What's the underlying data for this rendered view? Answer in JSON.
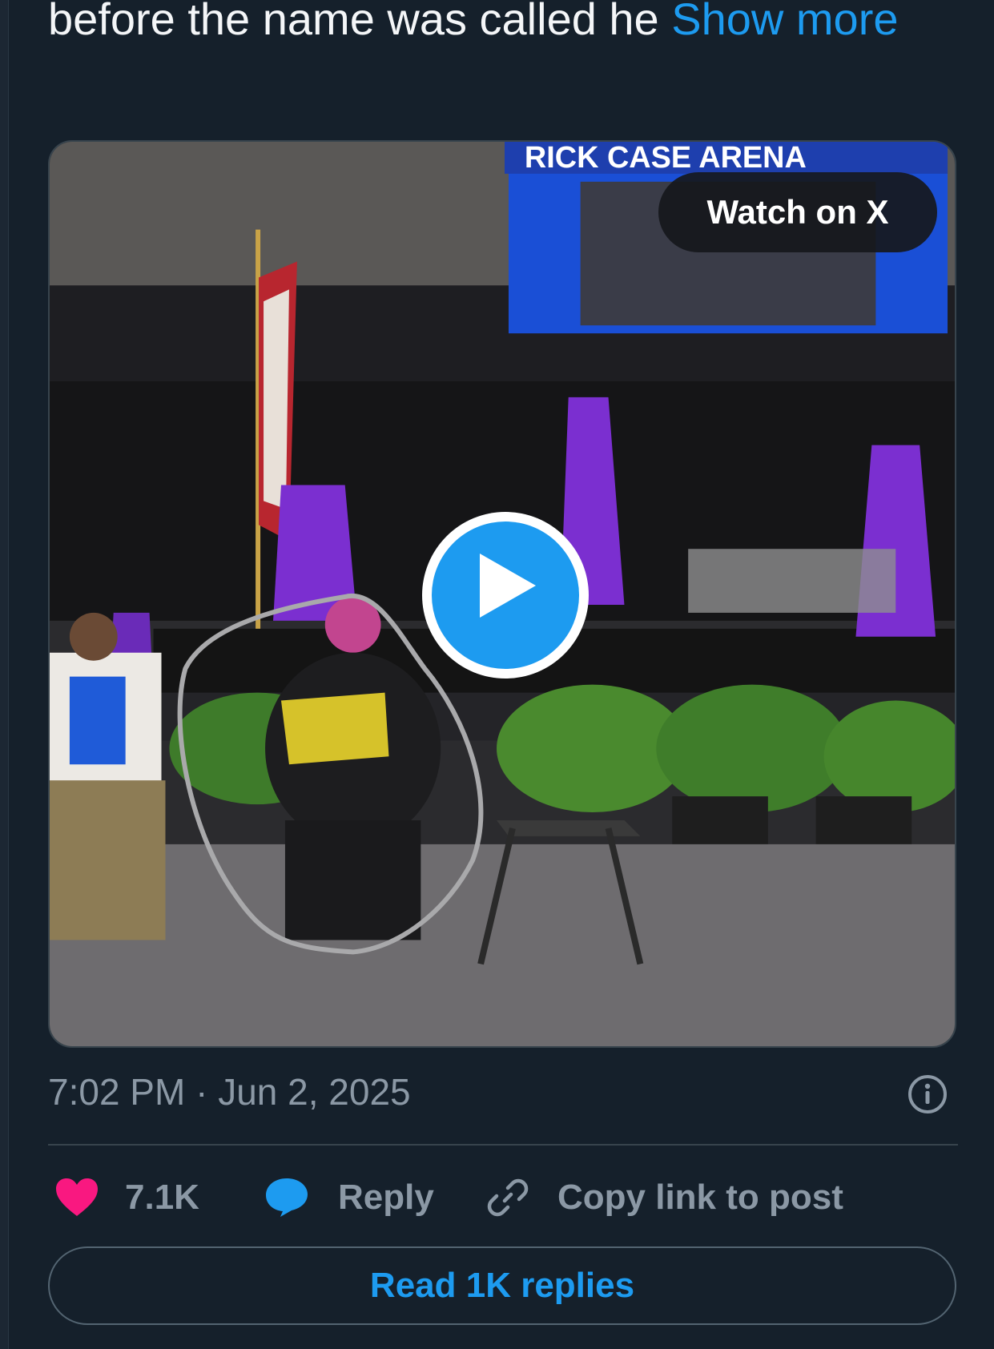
{
  "tweet": {
    "text": "before the name was called he ",
    "show_more": "Show more"
  },
  "media": {
    "watch_label": "Watch on X",
    "arena_sign": "RICK CASE ARENA",
    "play_icon": "play-icon"
  },
  "meta": {
    "timestamp": "7:02 PM · Jun 2, 2025",
    "info_icon": "info-icon"
  },
  "actions": {
    "likes": "7.1K",
    "reply_label": "Reply",
    "copy_label": "Copy link to post"
  },
  "read_replies_label": "Read 1K replies",
  "colors": {
    "background": "#15202b",
    "accent": "#1d9bf0",
    "like": "#f91880",
    "muted": "#8b98a5"
  }
}
